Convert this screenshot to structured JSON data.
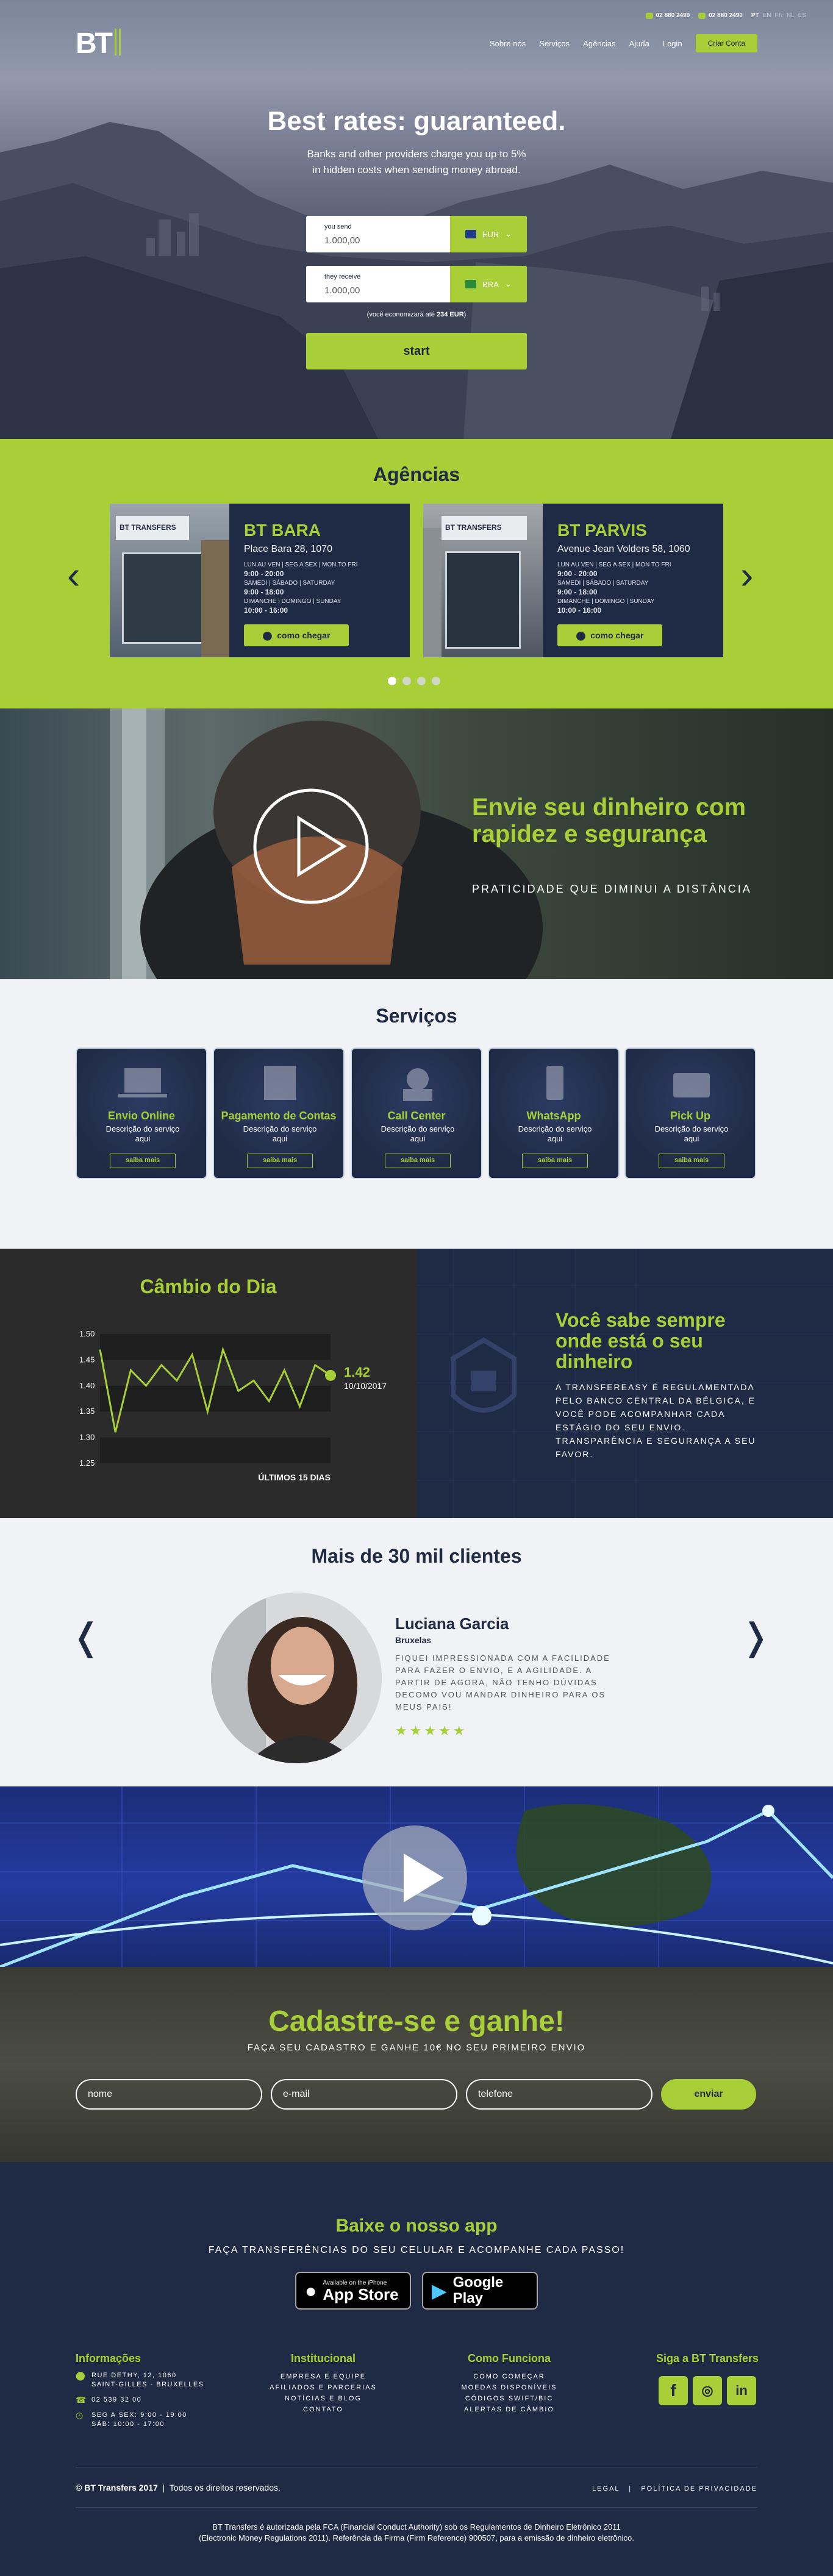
{
  "header": {
    "phone1": "02 880 2490",
    "phone2": "02 880 2490",
    "langs": [
      "PT",
      "EN",
      "FR",
      "NL",
      "ES"
    ],
    "logo": "BT",
    "nav": [
      "Sobre nós",
      "Serviços",
      "Agências",
      "Ajuda",
      "Login"
    ],
    "cta": "Criar Conta"
  },
  "hero": {
    "title": "Best rates: guaranteed.",
    "subtitle": "Banks and other providers charge you up to 5% in hidden costs when sending money abroad.",
    "send_label": "you send",
    "send_value": "1.000,00",
    "send_currency": "EUR",
    "receive_label": "they receive",
    "receive_value": "1.000,00",
    "receive_currency": "BRA",
    "economy_prefix": "(você economizará até",
    "economy_value": "234 EUR",
    "economy_suffix": ")",
    "start": "start"
  },
  "agencias": {
    "title": "Agências",
    "cards": [
      {
        "name": "BT BARA",
        "address": "Place Bara 28, 1070",
        "h1": "LUN AU VEN | SEG A SEX | MON TO FRI",
        "t1": "9:00 - 20:00",
        "h2": "SAMEDI | SÁBADO | SATURDAY",
        "t2": "9:00 - 18:00",
        "h3": "DIMANCHE | DOMINGO | SUNDAY",
        "t3": "10:00 - 16:00",
        "btn": "como chegar"
      },
      {
        "name": "BT PARVIS",
        "address": "Avenue Jean Volders 58, 1060",
        "h1": "LUN AU VEN | SEG A SEX | MON TO FRI",
        "t1": "9:00 - 20:00",
        "h2": "SAMEDI | SÁBADO | SATURDAY",
        "t2": "9:00 - 18:00",
        "h3": "DIMANCHE | DOMINGO | SUNDAY",
        "t3": "10:00 - 16:00",
        "btn": "como chegar"
      }
    ],
    "sign": "BT TRANSFERS"
  },
  "video": {
    "title": "Envie seu dinheiro com rapidez e segurança",
    "subtitle": "PRATICIDADE QUE DIMINUI A DISTÂNCIA"
  },
  "servicos": {
    "title": "Serviços",
    "items": [
      {
        "title": "Envio Online",
        "desc": "Descrição do serviço aqui",
        "btn": "saiba mais"
      },
      {
        "title": "Pagamento de Contas",
        "desc": "Descrição do serviço aqui",
        "btn": "saiba mais"
      },
      {
        "title": "Call Center",
        "desc": "Descrição do serviço aqui",
        "btn": "saiba mais"
      },
      {
        "title": "WhatsApp",
        "desc": "Descrição do serviço aqui",
        "btn": "saiba mais"
      },
      {
        "title": "Pick Up",
        "desc": "Descrição do serviço aqui",
        "btn": "saiba mais"
      }
    ]
  },
  "cambio": {
    "title": "Câmbio do Dia",
    "right_title": "Você sabe sempre onde está o seu dinheiro",
    "right_text": "A TRANSFEREASY É REGULAMENTADA PELO BANCO CENTRAL DA BÉLGICA, E VOCÊ PODE ACOMPANHAR CADA ESTÁGIO DO SEU ENVIO. TRANSPARÊNCIA E SEGURANÇA A SEU FAVOR."
  },
  "chart_data": {
    "type": "line",
    "title": "Câmbio do Dia",
    "xlabel": "ÚLTIMOS 15 DIAS",
    "ylabel": "",
    "yticks": [
      "1.50",
      "1.45",
      "1.40",
      "1.35",
      "1.30",
      "1.25"
    ],
    "ylim": [
      1.25,
      1.5
    ],
    "values": [
      1.47,
      1.31,
      1.43,
      1.4,
      1.44,
      1.41,
      1.46,
      1.35,
      1.47,
      1.39,
      1.41,
      1.37,
      1.43,
      1.36,
      1.44,
      1.42
    ],
    "last_value": "1.42",
    "last_date": "10/10/2017",
    "line_color": "#a9cf38",
    "band_color": "#1e1e1e",
    "grid": false
  },
  "clientes": {
    "title": "Mais de 30 mil clientes",
    "name": "Luciana Garcia",
    "city": "Bruxelas",
    "text": "FIQUEI IMPRESSIONADA COM A FACILIDADE PARA FAZER O ENVIO, E A AGILIDADE. A PARTIR DE AGORA, NÃO TENHO DÚVIDAS DECOMO VOU MANDAR DINHEIRO PARA OS MEUS PAIS!",
    "stars": "★★★★★"
  },
  "cadastro": {
    "title": "Cadastre-se e ganhe!",
    "subtitle": "FAÇA SEU CADASTRO E GANHE 10€ NO SEU PRIMEIRO ENVIO",
    "name_ph": "nome",
    "email_ph": "e-mail",
    "phone_ph": "telefone",
    "btn": "enviar"
  },
  "footer": {
    "app_title": "Baixe o nosso app",
    "app_sub": "FAÇA TRANSFERÊNCIAS DO SEU CELULAR E ACOMPANHE CADA PASSO!",
    "appstore_small": "Available on the iPhone",
    "appstore_big": "App Store",
    "google_big": "Google Play",
    "info_title": "Informações",
    "address1": "RUE DETHY, 12, 1060",
    "address2": "SAINT-GILLES - BRUXELLES",
    "phone": "02 539 32 00",
    "hours1": "SEG A SEX: 9:00 - 19:00",
    "hours2": "SÁB: 10:00 - 17:00",
    "inst_title": "Institucional",
    "inst_links": [
      "EMPRESA E EQUIPE",
      "AFILIADOS E PARCERIAS",
      "NOTÍCIAS E BLOG",
      "CONTATO"
    ],
    "how_title": "Como Funciona",
    "how_links": [
      "COMO COMEÇAR",
      "MOEDAS DISPONÍVEIS",
      "CÓDIGOS SWIFT/BIC",
      "ALERTAS DE CÂMBIO"
    ],
    "social_title": "Siga a BT Transfers",
    "copyright": "© BT Transfers 2017",
    "rights": "Todos os direitos reservados.",
    "legal": "LEGAL",
    "privacy": "POLÍTICA DE PRIVACIDADE",
    "disclaimer1": "BT Transfers é autorizada pela FCA (Financial Conduct Authority) sob os Regulamentos de Dinheiro Eletrônico 2011",
    "disclaimer2": "(Electronic Money Regulations 2011). Referência da Firma (Firm Reference) 900507, para a emissão de dinheiro eletrônico."
  }
}
